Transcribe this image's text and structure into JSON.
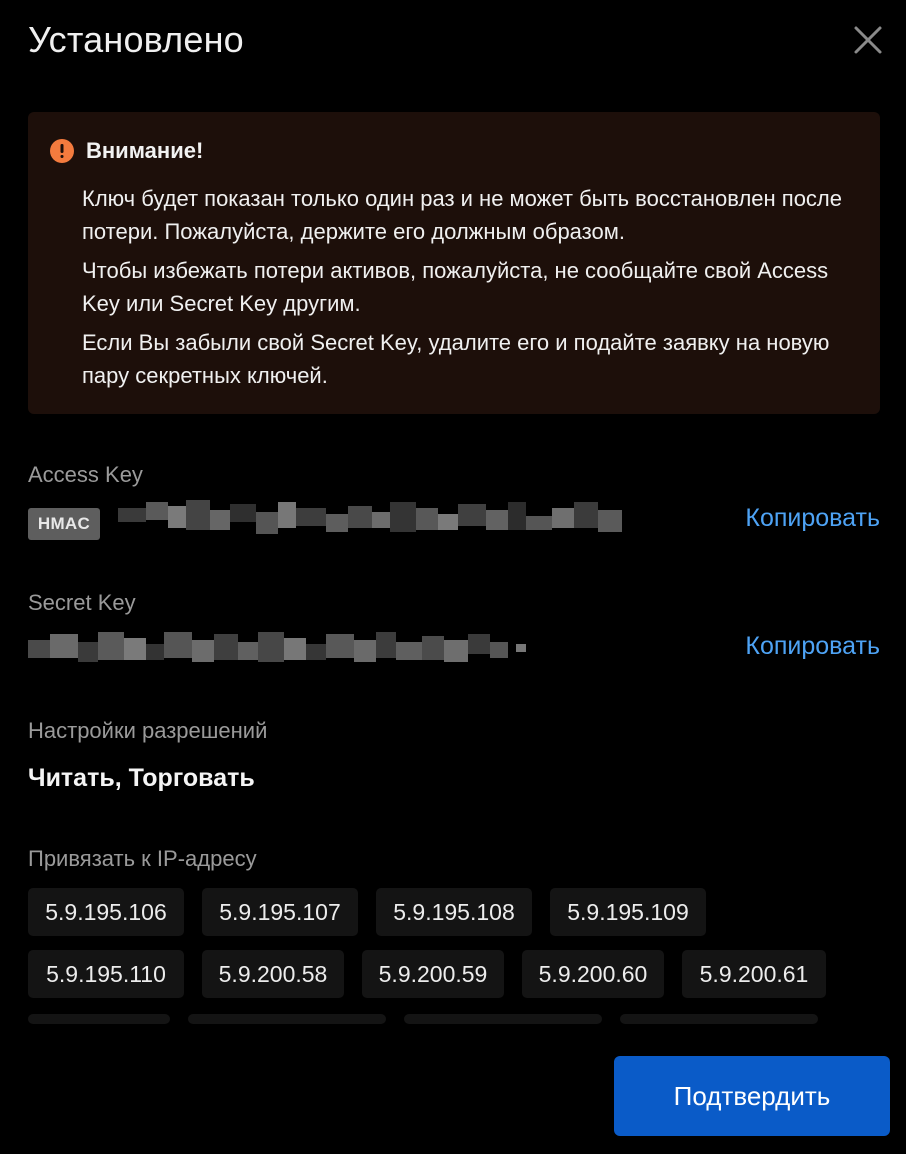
{
  "dialog": {
    "title": "Установлено",
    "close_icon": "close-icon"
  },
  "warning": {
    "icon": "exclamation-circle-icon",
    "title": "Внимание!",
    "paragraphs": [
      "Ключ будет показан только один раз и не может быть восстановлен после потери. Пожалуйста, держите его должным образом.",
      "Чтобы избежать потери активов, пожалуйста, не сообщайте свой Access Key или Secret Key другим.",
      "Если Вы забыли свой Secret Key, удалите его и подайте заявку на новую пару секретных ключей."
    ],
    "accent_color": "#f47b3e",
    "background_color": "#1d0f0a"
  },
  "access_key": {
    "label": "Access Key",
    "badge": "HMAC",
    "value_masked": true,
    "copy_label": "Копировать"
  },
  "secret_key": {
    "label": "Secret Key",
    "value_masked": true,
    "copy_label": "Копировать"
  },
  "permissions": {
    "label": "Настройки разрешений",
    "value": "Читать, Торговать"
  },
  "ip_binding": {
    "label": "Привязать к IP-адресу",
    "addresses": [
      "5.9.195.106",
      "5.9.195.107",
      "5.9.195.108",
      "5.9.195.109",
      "5.9.195.110",
      "5.9.200.58",
      "5.9.200.59",
      "5.9.200.60",
      "5.9.200.61"
    ]
  },
  "footer": {
    "confirm_label": "Подтвердить"
  },
  "colors": {
    "link": "#4ea3f5",
    "primary_button": "#0a5bc8",
    "chip_bg": "#141414",
    "muted_text": "#9a9a9a"
  }
}
